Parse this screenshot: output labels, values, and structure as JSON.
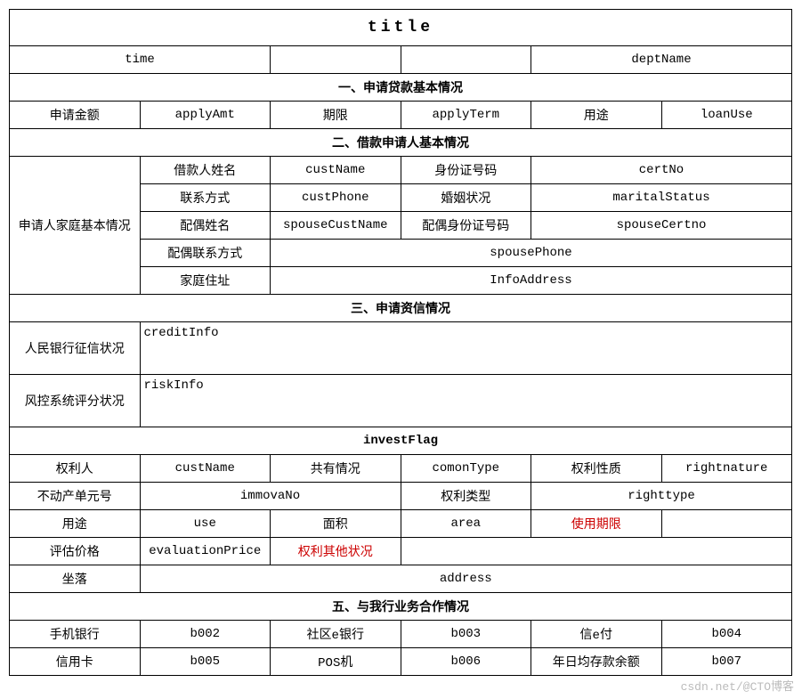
{
  "title": "title",
  "header_row": {
    "time": "time",
    "deptName": "deptName"
  },
  "section1": {
    "title": "一、申请贷款基本情况",
    "r1": {
      "c1": "申请金额",
      "c2": "applyAmt",
      "c3": "期限",
      "c4": "applyTerm",
      "c5": "用途",
      "c6": "loanUse"
    }
  },
  "section2": {
    "title": "二、借款申请人基本情况",
    "rowspan_label": "申请人家庭基本情况",
    "r1": {
      "c1": "借款人姓名",
      "c2": "custName",
      "c3": "身份证号码",
      "c4": "certNo"
    },
    "r2": {
      "c1": "联系方式",
      "c2": "custPhone",
      "c3": "婚姻状况",
      "c4": "maritalStatus"
    },
    "r3": {
      "c1": "配偶姓名",
      "c2": "spouseCustName",
      "c3": "配偶身份证号码",
      "c4": "spouseCertno"
    },
    "r4": {
      "c1": "配偶联系方式",
      "c2": "spousePhone"
    },
    "r5": {
      "c1": "家庭住址",
      "c2": "InfoAddress"
    }
  },
  "section3": {
    "title": "三、申请资信情况",
    "r1": {
      "label": "人民银行征信状况",
      "value": "creditInfo"
    },
    "r2": {
      "label": "风控系统评分状况",
      "value": "riskInfo"
    }
  },
  "section4": {
    "title": "investFlag",
    "r1": {
      "c1": "权利人",
      "c2": "custName",
      "c3": "共有情况",
      "c4": "comonType",
      "c5": "权利性质",
      "c6": "rightnature"
    },
    "r2": {
      "c1": "不动产单元号",
      "c2": "immovaNo",
      "c3": "权利类型",
      "c4": "righttype"
    },
    "r3": {
      "c1": "用途",
      "c2": "use",
      "c3": "面积",
      "c4": "area",
      "c5": "使用期限"
    },
    "r4": {
      "c1": "评估价格",
      "c2": "evaluationPrice",
      "c3": "权利其他状况"
    },
    "r5": {
      "c1": "坐落",
      "c2": "address"
    }
  },
  "section5": {
    "title": "五、与我行业务合作情况",
    "r1": {
      "c1": "手机银行",
      "c2": "b002",
      "c3": "社区e银行",
      "c4": "b003",
      "c5": "信e付",
      "c6": "b004"
    },
    "r2": {
      "c1": "信用卡",
      "c2": "b005",
      "c3": "POS机",
      "c4": "b006",
      "c5": "年日均存款余额",
      "c6": "b007"
    }
  },
  "watermark": "csdn.net/@CTO博客"
}
